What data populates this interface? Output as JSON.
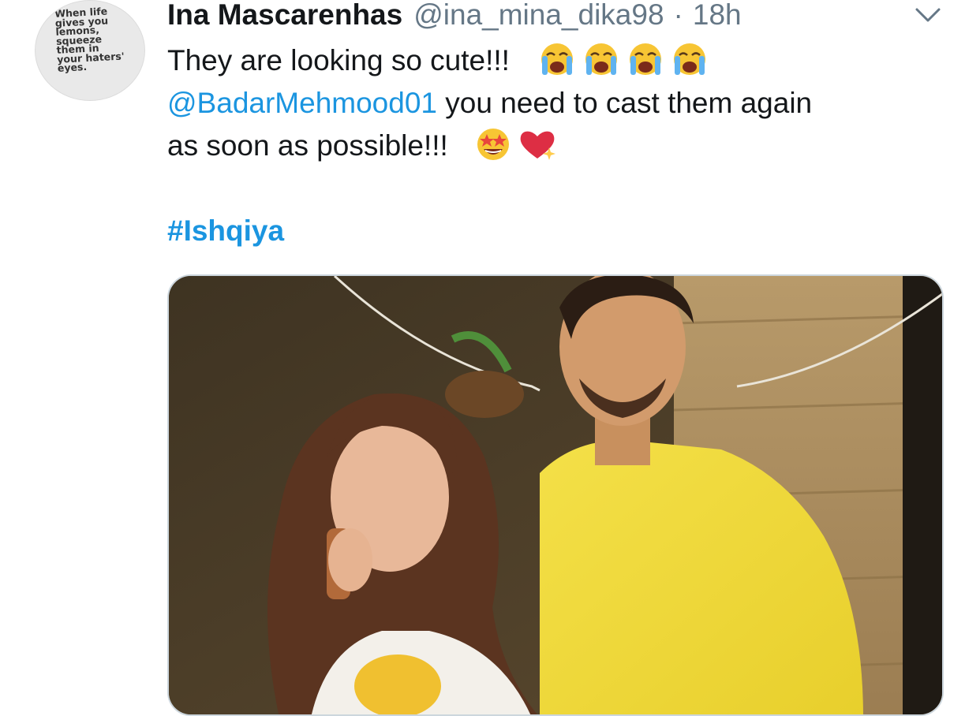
{
  "tweet": {
    "avatar_text": "When life\ngives you\nlemons,\nsqueeze\nthem in\nyour haters'\neyes.",
    "display_name": "Ina Mascarenhas",
    "handle": "@ina_mina_dika98",
    "separator": "·",
    "time": "18h",
    "menu_icon": "chevron-down-icon",
    "text_line1": "They are looking so cute!!!",
    "line1_emojis": [
      "loudly-crying-face-icon",
      "loudly-crying-face-icon",
      "loudly-crying-face-icon",
      "loudly-crying-face-icon"
    ],
    "mention": "@BadarMehmood01",
    "text_line2_rest": " you need to cast them again",
    "text_line3": "as soon as possible!!!",
    "line3_emojis": [
      "star-struck-icon",
      "sparkling-heart-icon"
    ],
    "hashtag": "#Ishqiya",
    "media_description_icon": "photo"
  },
  "colors": {
    "link": "#1b95e0",
    "text": "#14171a",
    "secondary": "#657786",
    "media_border": "#ccd6dd"
  }
}
